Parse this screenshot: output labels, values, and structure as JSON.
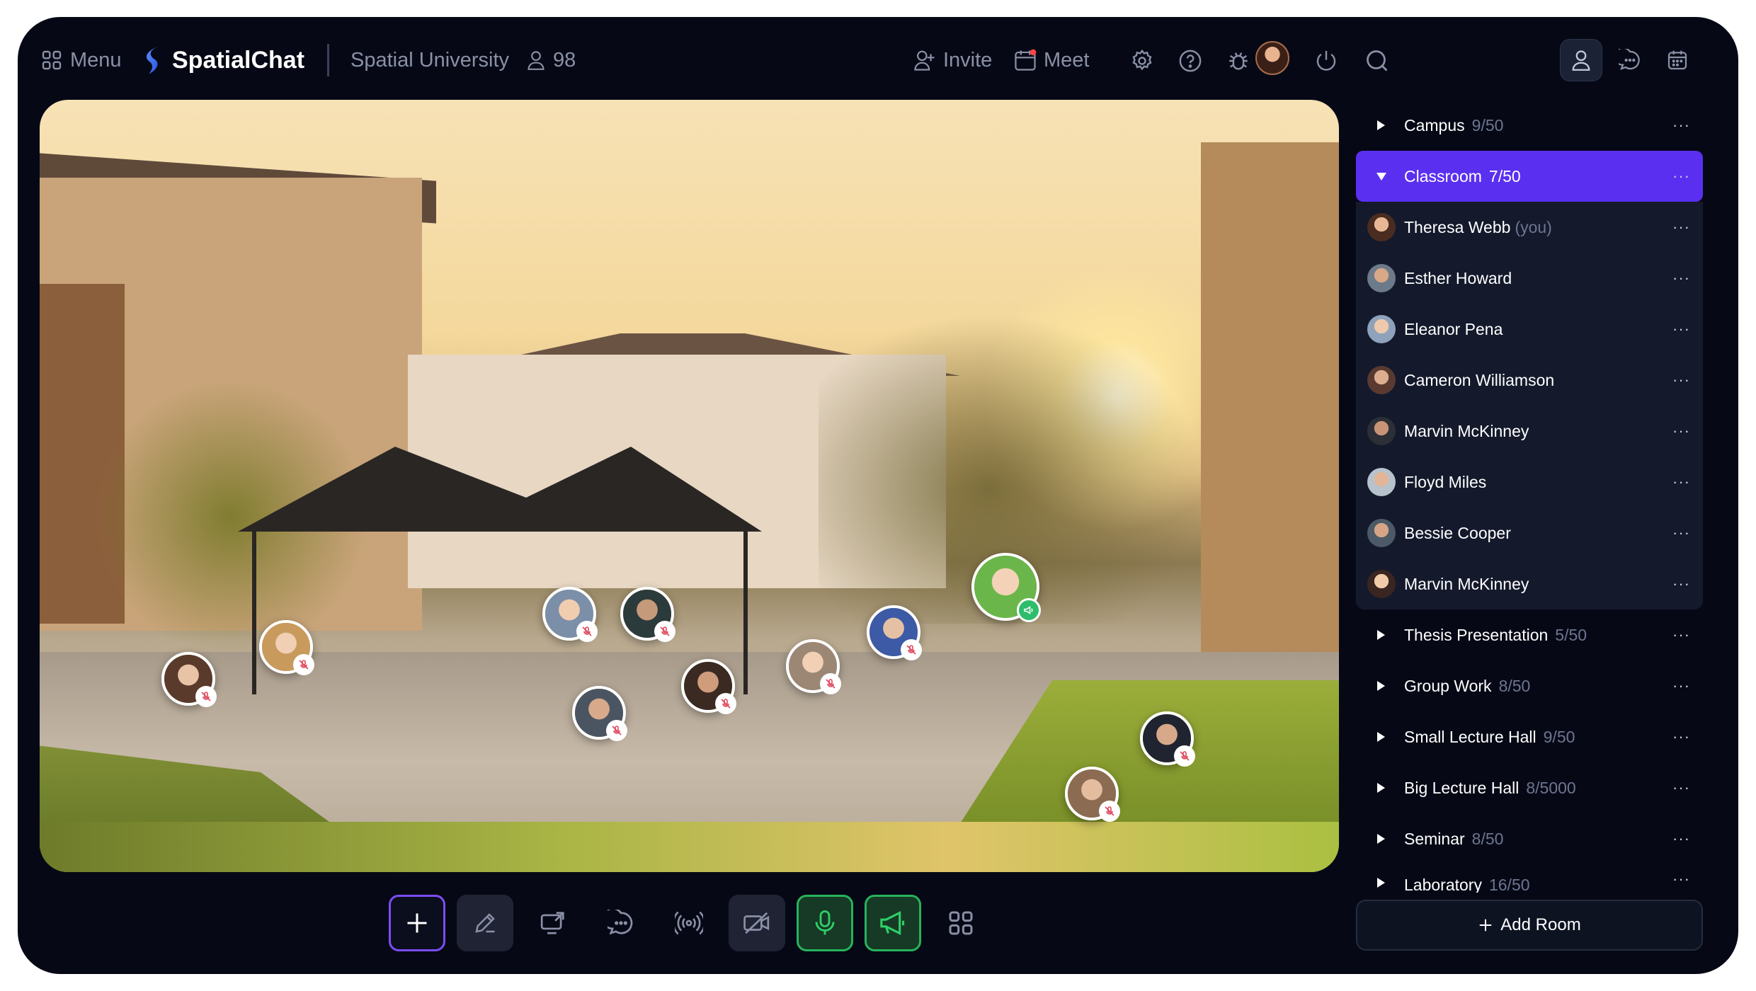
{
  "topbar": {
    "menu_label": "Menu",
    "brand": "SpatialChat",
    "org": "Spatial University",
    "people_count": "98",
    "invite_label": "Invite",
    "meet_label": "Meet"
  },
  "rooms_top": [
    {
      "name": "Campus",
      "count": "9/50"
    },
    {
      "name": "Classroom",
      "count": "7/50"
    }
  ],
  "members": [
    {
      "name": "Theresa Webb",
      "suffix": "(you)"
    },
    {
      "name": "Esther Howard",
      "suffix": ""
    },
    {
      "name": "Eleanor Pena",
      "suffix": ""
    },
    {
      "name": "Cameron Williamson",
      "suffix": ""
    },
    {
      "name": "Marvin McKinney",
      "suffix": ""
    },
    {
      "name": "Floyd Miles",
      "suffix": ""
    },
    {
      "name": "Bessie Cooper",
      "suffix": ""
    },
    {
      "name": "Marvin McKinney",
      "suffix": ""
    }
  ],
  "rooms_bottom": [
    {
      "name": "Thesis Presentation",
      "count": "5/50"
    },
    {
      "name": "Group Work",
      "count": "8/50"
    },
    {
      "name": "Small Lecture Hall",
      "count": "9/50"
    },
    {
      "name": "Big Lecture Hall",
      "count": "8/5000"
    },
    {
      "name": "Seminar",
      "count": "8/50"
    },
    {
      "name": "Laboratory",
      "count": "16/50"
    }
  ],
  "row_menu_glyph": "···",
  "add_room_label": "Add Room",
  "colors": {
    "app_bg": "#060915",
    "accent": "#5b2ff0",
    "green": "#27b35b",
    "muted_text": "#6e7591"
  },
  "icons": {
    "menu": "grid-icon",
    "brand": "spatialchat-logo",
    "people": "person-icon",
    "invite": "add-user-icon",
    "meet": "calendar-icon",
    "settings": "gear-icon",
    "help": "question-icon",
    "bug": "bug-icon",
    "power": "power-icon",
    "search": "search-icon",
    "users_tab": "person-icon",
    "chat_tab": "chat-icon",
    "calendar_tab": "calendar-icon"
  }
}
